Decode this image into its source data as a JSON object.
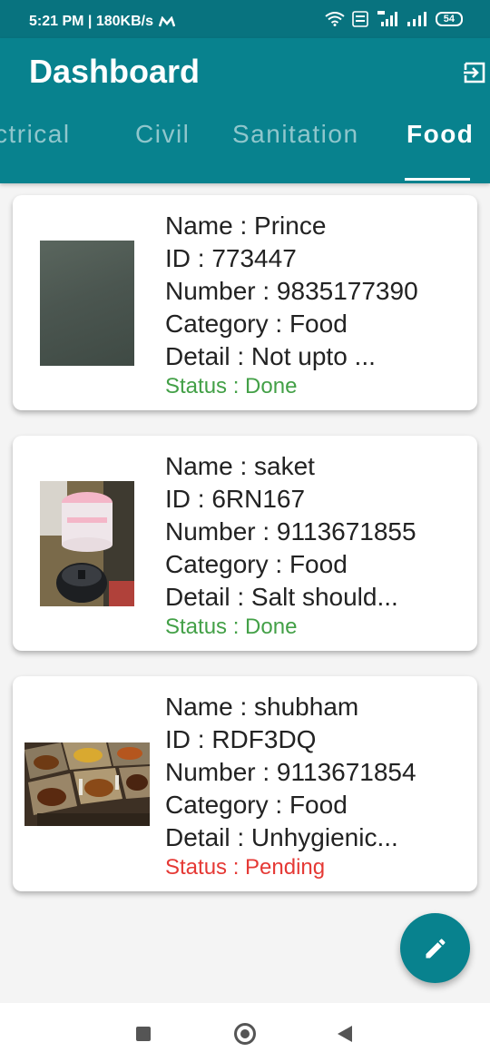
{
  "status_bar": {
    "time_speed": "5:21 PM | 180KB/s",
    "battery": "54",
    "icons": [
      "m-logo-icon",
      "wifi-icon",
      "volte-icon",
      "signal-4g-icon",
      "signal-icon",
      "battery-icon"
    ]
  },
  "header": {
    "title": "Dashboard",
    "logout_icon": "logout-icon"
  },
  "tabs": [
    {
      "label": "Electrical"
    },
    {
      "label": "Civil"
    },
    {
      "label": "Sanitation"
    },
    {
      "label": "Food",
      "active": true
    }
  ],
  "cards": [
    {
      "name": "Name : Prince",
      "id": "ID : 773447",
      "number": "Number : 9835177390",
      "category": "Category : Food",
      "detail": "Detail : Not upto ...",
      "status": "Status : Done"
    },
    {
      "name": "Name : saket",
      "id": "ID : 6RN167",
      "number": "Number : 9113671855",
      "category": "Category : Food",
      "detail": "Detail : Salt should...",
      "status": "Status : Done"
    },
    {
      "name": "Name : shubham",
      "id": "ID : RDF3DQ",
      "number": "Number : 9113671854",
      "category": "Category : Food",
      "detail": "Detail : Unhygienic...",
      "status": "Status : Pending"
    }
  ],
  "colors": {
    "primary": "#08828e",
    "status_bar": "#08737f",
    "status_done": "#43a047",
    "status_pending": "#e53935",
    "background": "#f4f4f4"
  },
  "fab": {
    "icon": "pencil-icon"
  },
  "nav": {
    "icons": [
      "recents-icon",
      "home-icon",
      "back-icon"
    ]
  }
}
